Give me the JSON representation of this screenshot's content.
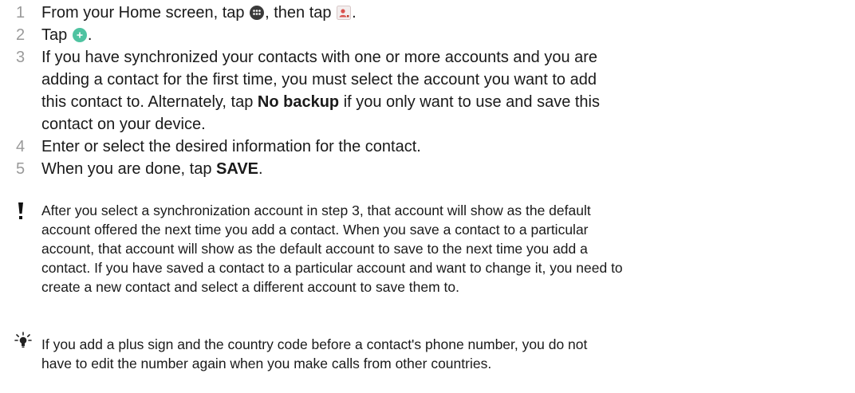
{
  "steps": [
    {
      "num": "1",
      "parts": [
        "From your Home screen, tap ",
        ", then tap ",
        "."
      ],
      "icons": [
        "apps-grid-icon",
        "contacts-app-icon"
      ]
    },
    {
      "num": "2",
      "parts": [
        "Tap ",
        "."
      ],
      "icons": [
        "add-contact-fab-icon"
      ]
    },
    {
      "num": "3",
      "lines": [
        "If you have synchronized your contacts with one or more accounts and you are",
        "adding a contact for the first time, you must select the account you want to add"
      ],
      "line3_pre": "this contact to. Alternately, tap ",
      "line3_bold": "No backup",
      "line3_post": " if you only want to use and save this",
      "line4": "contact on your device."
    },
    {
      "num": "4",
      "text": "Enter or select the desired information for the contact."
    },
    {
      "num": "5",
      "pre": "When you are done, tap ",
      "bold": "SAVE",
      "post": "."
    }
  ],
  "warning_note": {
    "icon": "exclamation-icon",
    "lines": [
      "After you select a synchronization account in step 3, that account will show as the default",
      "account offered the next time you add a contact. When you save a contact to a particular",
      "account, that account will show as the default account to save to the next time you add a",
      "contact. If you have saved a contact to a particular account and want to change it, you need to",
      "create a new contact and select a different account to save them to."
    ]
  },
  "tip_note": {
    "icon": "lightbulb-tip-icon",
    "lines": [
      "If you add a plus sign and the country code before a contact's phone number, you do not",
      "have to edit the number again when you make calls from other countries."
    ]
  },
  "colors": {
    "step_number": "#9a9a9a",
    "text": "#1a1a1a",
    "fab_green": "#4fc3a1"
  }
}
